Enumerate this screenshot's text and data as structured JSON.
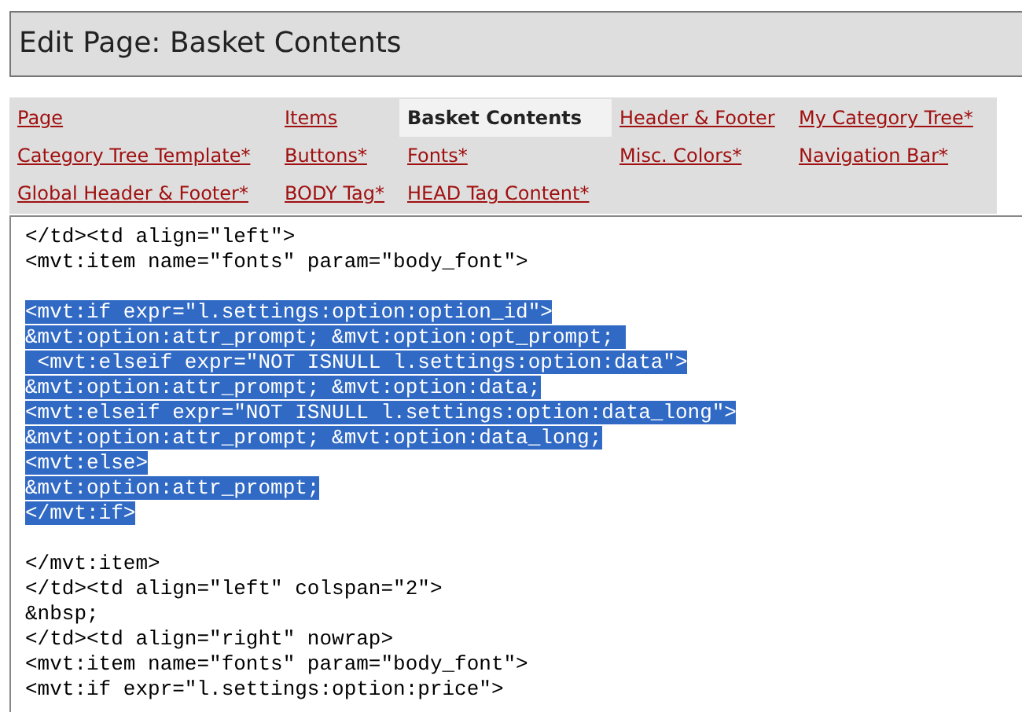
{
  "page_title": "Edit Page: Basket Contents",
  "tabs": [
    {
      "label": "Page",
      "selected": false
    },
    {
      "label": "Items",
      "selected": false
    },
    {
      "label": "Basket Contents",
      "selected": true
    },
    {
      "label": "Header & Footer",
      "selected": false
    },
    {
      "label": "My Category Tree*",
      "selected": false
    },
    {
      "label": "Category Tree Template*",
      "selected": false
    },
    {
      "label": "Buttons*",
      "selected": false
    },
    {
      "label": "Fonts*",
      "selected": false
    },
    {
      "label": "Misc. Colors*",
      "selected": false
    },
    {
      "label": "Navigation Bar*",
      "selected": false
    },
    {
      "label": "Global Header & Footer*",
      "selected": false
    },
    {
      "label": "BODY Tag*",
      "selected": false
    },
    {
      "label": "HEAD Tag Content*",
      "selected": false
    }
  ],
  "editor": {
    "blocks": [
      {
        "lines": [
          {
            "text": "</td><td align=\"left\">",
            "selected": false
          },
          {
            "text": "<mvt:item name=\"fonts\" param=\"body_font\">",
            "selected": false
          }
        ]
      },
      {
        "lines": [
          {
            "text": "<mvt:if expr=\"l.settings:option:option_id\">",
            "selected": true
          },
          {
            "text": "&mvt:option:attr_prompt; &mvt:option:opt_prompt; ",
            "selected": true
          },
          {
            "text": " <mvt:elseif expr=\"NOT ISNULL l.settings:option:data\">",
            "selected": true
          },
          {
            "text": "&mvt:option:attr_prompt; &mvt:option:data;",
            "selected": true
          },
          {
            "text": "<mvt:elseif expr=\"NOT ISNULL l.settings:option:data_long\">",
            "selected": true
          },
          {
            "text": "&mvt:option:attr_prompt; &mvt:option:data_long;",
            "selected": true
          },
          {
            "text": "<mvt:else>",
            "selected": true
          },
          {
            "text": "&mvt:option:attr_prompt;",
            "selected": true
          },
          {
            "text": "</mvt:if>",
            "selected": true
          }
        ]
      },
      {
        "lines": [
          {
            "text": "</mvt:item>",
            "selected": false
          },
          {
            "text": "</td><td align=\"left\" colspan=\"2\">",
            "selected": false
          },
          {
            "text": "&nbsp;",
            "selected": false
          },
          {
            "text": "</td><td align=\"right\" nowrap>",
            "selected": false
          },
          {
            "text": "<mvt:item name=\"fonts\" param=\"body_font\">",
            "selected": false
          },
          {
            "text": "<mvt:if expr=\"l.settings:option:price\">",
            "selected": false
          }
        ]
      }
    ]
  }
}
